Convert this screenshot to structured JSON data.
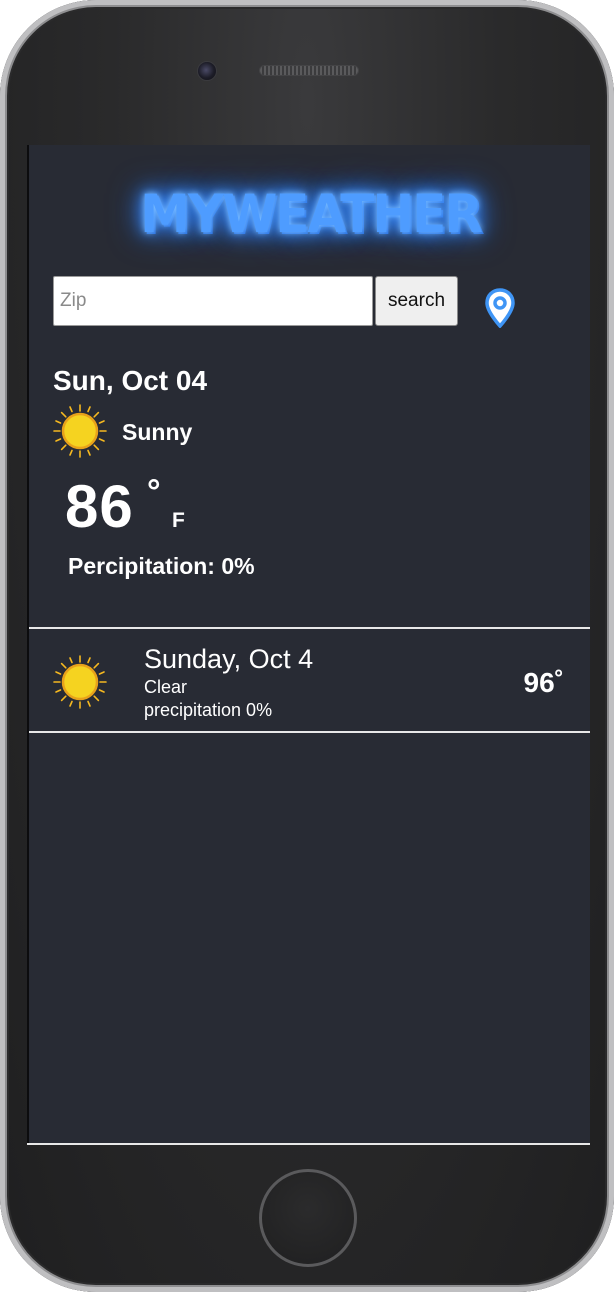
{
  "app": {
    "logo_text": "MYWEATHER"
  },
  "search": {
    "placeholder": "Zip",
    "value": "",
    "button_label": "search"
  },
  "current": {
    "date": "Sun, Oct 04",
    "condition": "Sunny",
    "temp": "86",
    "degree": "°",
    "unit": "F",
    "precipitation": "Percipitation: 0%",
    "icon": "sun-icon"
  },
  "forecast": [
    {
      "day": "Sunday, Oct 4",
      "condition": "Clear",
      "precipitation": "precipitation 0%",
      "temp": "96˚",
      "icon": "sun-icon"
    }
  ],
  "colors": {
    "screen_bg": "#282b34",
    "logo_blue": "#4e9cff",
    "sun_yellow": "#f5d320",
    "pin_blue": "#3f95f5"
  }
}
